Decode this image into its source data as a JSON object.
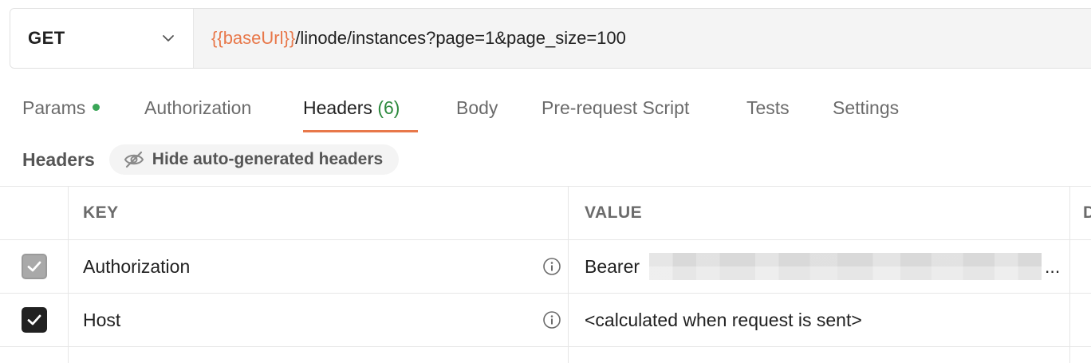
{
  "request": {
    "method": "GET",
    "url_variable": "{{baseUrl}}",
    "url_path": "/linode/instances?page=1&page_size=100"
  },
  "tabs": [
    {
      "label": "Params",
      "has_dot": true
    },
    {
      "label": "Authorization"
    },
    {
      "label": "Headers",
      "count": "(6)",
      "active": true
    },
    {
      "label": "Body"
    },
    {
      "label": "Pre-request Script"
    },
    {
      "label": "Tests"
    },
    {
      "label": "Settings"
    }
  ],
  "headers_section": {
    "title": "Headers",
    "hide_button_label": "Hide auto-generated headers"
  },
  "table": {
    "columns": {
      "key": "KEY",
      "value": "VALUE",
      "description": "D"
    },
    "rows": [
      {
        "checked": true,
        "disabled": true,
        "key": "Authorization",
        "value": "Bearer",
        "value_redacted": true,
        "value_truncated": "..."
      },
      {
        "checked": true,
        "disabled": false,
        "key": "Host",
        "value": "<calculated when request is sent>"
      }
    ]
  },
  "colors": {
    "accent": "#e8784a",
    "count_green": "#2e8a3e",
    "dot_green": "#3aa657"
  }
}
